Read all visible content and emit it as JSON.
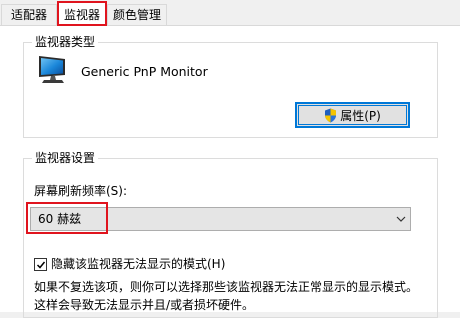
{
  "tabs": [
    {
      "label": "适配器"
    },
    {
      "label": "监视器"
    },
    {
      "label": "颜色管理"
    }
  ],
  "monitor_type_group": {
    "title": "监视器类型",
    "monitor_name": "Generic PnP Monitor",
    "properties_button": "属性(P)"
  },
  "monitor_settings_group": {
    "title": "监视器设置",
    "refresh_rate_label": "屏幕刷新频率(S):",
    "refresh_rate_value": "60 赫兹",
    "hide_modes_checkbox_label": "隐藏该监视器无法显示的模式(H)",
    "hide_modes_checked": true,
    "description_line1": "如果不复选该项，则你可以选择那些该监视器无法正常显示的显示模式。",
    "description_line2": "这样会导致无法显示并且/或者损坏硬件。"
  },
  "colors": {
    "highlight_red": "#e0141e",
    "focus_blue": "#0078d7"
  },
  "icons": {
    "monitor": "monitor-icon",
    "shield": "uac-shield-icon",
    "dropdown": "chevron-down-icon",
    "check": "checkmark-icon"
  }
}
